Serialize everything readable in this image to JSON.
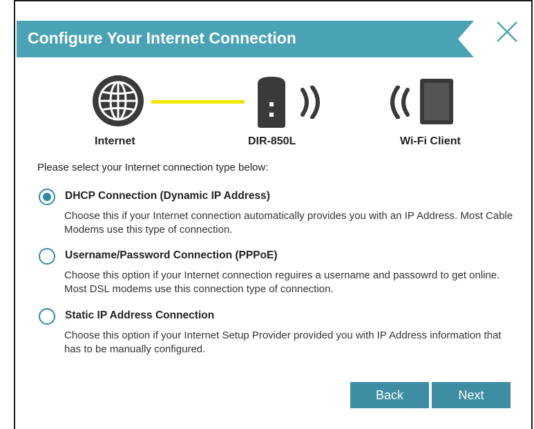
{
  "header": {
    "title": "Configure Your Internet Connection"
  },
  "diagram": {
    "internet_label": "Internet",
    "router_label": "DIR-850L",
    "client_label": "Wi-Fi Client"
  },
  "prompt": "Please select your Internet connection type below:",
  "options": [
    {
      "title": "DHCP Connection (Dynamic IP Address)",
      "description": "Choose this if your Internet connection automatically provides you with an IP Address. Most Cable Modems use this type of connection.",
      "selected": true
    },
    {
      "title": "Username/Password Connection (PPPoE)",
      "description": "Choose this option if your Internet connection reguires a username and passowrd to get online. Most DSL modems use this connection type of connection.",
      "selected": false
    },
    {
      "title": "Static IP Address Connection",
      "description": "Choose this option if your Internet Setup Provider provided you with IP Address information that has to be manually configured.",
      "selected": false
    }
  ],
  "buttons": {
    "back": "Back",
    "next": "Next"
  },
  "colors": {
    "accent": "#3d8ea3",
    "banner": "#4aa3b5",
    "link_line": "#f2e600"
  }
}
